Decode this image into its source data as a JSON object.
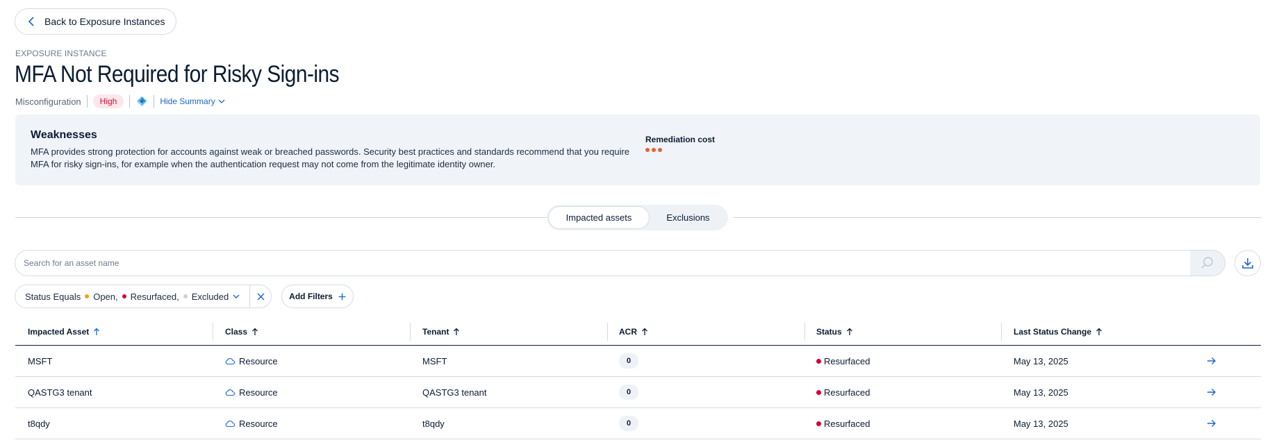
{
  "nav": {
    "back_label": "Back to Exposure Instances"
  },
  "header": {
    "eyebrow": "EXPOSURE INSTANCE",
    "title": "MFA Not Required for Risky Sign-ins",
    "type": "Misconfiguration",
    "severity": "High",
    "provider_icon": "azure-icon",
    "hide_summary_label": "Hide Summary"
  },
  "summary": {
    "weakness_title": "Weaknesses",
    "weakness_text": "MFA provides strong protection for accounts against weak or breached passwords. Security best practices and standards recommend that you require MFA for risky sign-ins, for example when the authentication request may not come from the legitimate identity owner.",
    "remediation_label": "Remediation cost",
    "remediation_level": 3
  },
  "tabs": [
    {
      "label": "Impacted assets",
      "active": true
    },
    {
      "label": "Exclusions",
      "active": false
    }
  ],
  "search": {
    "placeholder": "Search for an asset name",
    "value": ""
  },
  "filter": {
    "prefix": "Status Equals",
    "values": [
      {
        "label": "Open,",
        "color": "#f0a500"
      },
      {
        "label": "Resurfaced,",
        "color": "#d6003a"
      },
      {
        "label": "Excluded",
        "color": "#c9d1dc"
      }
    ],
    "add_label": "Add Filters"
  },
  "table": {
    "columns": [
      "Impacted Asset",
      "Class",
      "Tenant",
      "ACR",
      "Status",
      "Last Status Change"
    ],
    "rows": [
      {
        "asset": "MSFT",
        "class": "Resource",
        "tenant": "MSFT",
        "acr": "0",
        "status": "Resurfaced",
        "date": "May 13, 2025"
      },
      {
        "asset": "QASTG3 tenant",
        "class": "Resource",
        "tenant": "QASTG3 tenant",
        "acr": "0",
        "status": "Resurfaced",
        "date": "May 13, 2025"
      },
      {
        "asset": "t8qdy",
        "class": "Resource",
        "tenant": "t8qdy",
        "acr": "0",
        "status": "Resurfaced",
        "date": "May 13, 2025"
      }
    ]
  },
  "colors": {
    "accent": "#1a66c9",
    "severity_high": "#c8102e",
    "status_resurfaced": "#d6003a",
    "remediation": "#e8603c"
  }
}
